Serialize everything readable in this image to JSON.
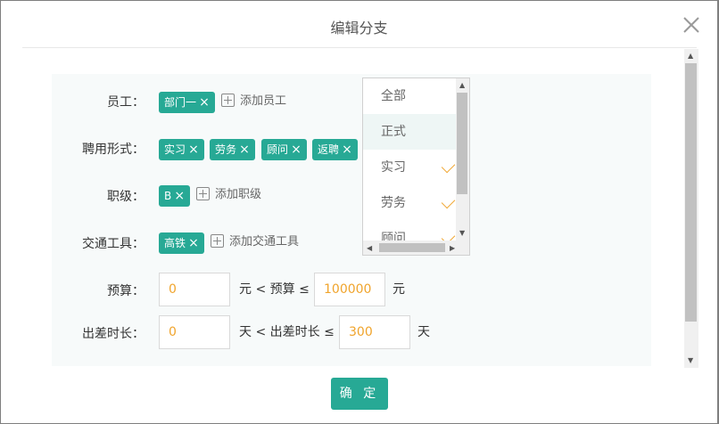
{
  "dialog": {
    "title": "编辑分支"
  },
  "form": {
    "employee": {
      "label": "员工：",
      "tags": [
        "部门一"
      ],
      "add_label": "添加员工"
    },
    "employment": {
      "label": "聘用形式：",
      "tags": [
        "实习",
        "劳务",
        "顾问",
        "返聘"
      ]
    },
    "level": {
      "label": "职级：",
      "tags": [
        "B"
      ],
      "add_label": "添加职级"
    },
    "transport": {
      "label": "交通工具：",
      "tags": [
        "高铁"
      ],
      "add_label": "添加交通工具"
    },
    "budget": {
      "label": "预算：",
      "min": "0",
      "mid_text": "元 < 预算 ≤",
      "max": "100000",
      "unit": "元"
    },
    "duration": {
      "label": "出差时长：",
      "min": "0",
      "mid_text": "天 < 出差时长 ≤",
      "max": "300",
      "unit": "天"
    }
  },
  "dropdown": {
    "options": [
      {
        "label": "全部",
        "checked": false,
        "highlighted": false
      },
      {
        "label": "正式",
        "checked": false,
        "highlighted": true
      },
      {
        "label": "实习",
        "checked": true,
        "highlighted": false
      },
      {
        "label": "劳务",
        "checked": true,
        "highlighted": false
      },
      {
        "label": "顾问",
        "checked": true,
        "highlighted": false
      }
    ]
  },
  "footer": {
    "confirm_label": "确 定"
  },
  "icons": {
    "close": "close-icon",
    "remove": "×",
    "add": "plus-square-icon"
  },
  "colors": {
    "accent": "#27a995",
    "number": "#f0a42c",
    "check": "#f0a42c"
  }
}
